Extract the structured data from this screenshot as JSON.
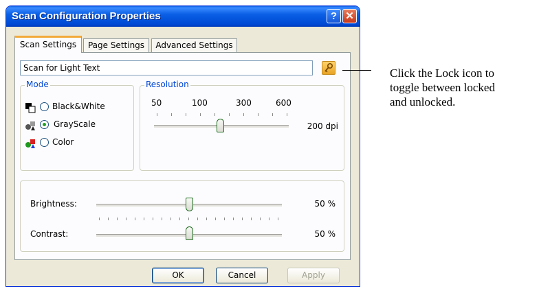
{
  "window": {
    "title": "Scan Configuration Properties",
    "help_label": "?",
    "close_label": "✕"
  },
  "tabs": [
    {
      "label": "Scan Settings",
      "active": true
    },
    {
      "label": "Page Settings",
      "active": false
    },
    {
      "label": "Advanced Settings",
      "active": false
    }
  ],
  "preset": {
    "value": "Scan for Light Text",
    "lock_icon": "lock-icon"
  },
  "mode": {
    "label": "Mode",
    "options": [
      {
        "label": "Black&White",
        "icon": "black-white-icon",
        "selected": false
      },
      {
        "label": "GrayScale",
        "icon": "grayscale-icon",
        "selected": true
      },
      {
        "label": "Color",
        "icon": "color-icon",
        "selected": false
      }
    ]
  },
  "resolution": {
    "label": "Resolution",
    "ticks": [
      "50",
      "100",
      "300",
      "600"
    ],
    "value_text": "200 dpi"
  },
  "brightness": {
    "label": "Brightness:",
    "value_text": "50 %",
    "value": 50
  },
  "contrast": {
    "label": "Contrast:",
    "value_text": "50 %",
    "value": 50
  },
  "buttons": {
    "ok": "OK",
    "cancel": "Cancel",
    "apply": "Apply"
  },
  "callout": {
    "lines": [
      "Click the Lock icon to",
      "toggle between locked",
      "and unlocked."
    ]
  },
  "colors": {
    "titlebar": "#0a5fe5",
    "group_label": "#0046d5",
    "tab_accent": "#f3a93a",
    "thumb_border": "#1f6f1f"
  }
}
